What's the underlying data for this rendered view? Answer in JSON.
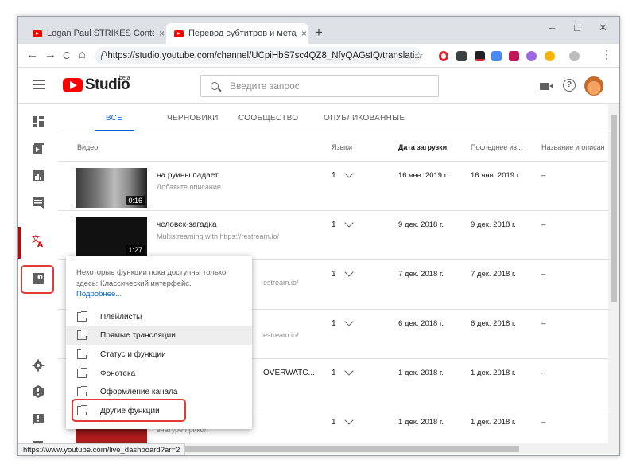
{
  "browser": {
    "tabs": [
      {
        "title": "Logan Paul STRIKES Content, Poi",
        "close": "×",
        "active": false
      },
      {
        "title": "Перевод субтитров и метаданн",
        "close": "×",
        "active": true
      }
    ],
    "new_tab": "+",
    "window_controls": [
      "–",
      "☐",
      "✕"
    ],
    "url": "https://studio.youtube.com/channel/UCpiHbS7sc4QZ8_NfyQAGsIQ/translati...",
    "nav": {
      "back": "←",
      "forward": "→",
      "reload": "C",
      "home": "⌂"
    },
    "star": "☆",
    "menu": "⋮",
    "status_url": "https://www.youtube.com/live_dashboard?ar=2"
  },
  "studio": {
    "logo_text": "Studio",
    "logo_badge": "beta",
    "search_placeholder": "Введите запрос",
    "help": "?"
  },
  "content_tabs": [
    "ВСЕ",
    "ЧЕРНОВИКИ",
    "СООБЩЕСТВО",
    "ОПУБЛИКОВАННЫЕ"
  ],
  "table": {
    "headers": {
      "video": "Видео",
      "languages": "Языки",
      "upload_date": "Дата загрузки",
      "last": "Последнее из...",
      "name_desc": "Название и описан"
    },
    "rows": [
      {
        "title": "на руины падает",
        "desc": "Добавьте описание",
        "duration": "0:16",
        "lang": "1",
        "date": "16 янв. 2019 г.",
        "last": "16 янв. 2019 г.",
        "name": "–"
      },
      {
        "title": "человек-загадка",
        "desc": "Multistreaming with https://restream.io/",
        "duration": "1:27",
        "lang": "1",
        "date": "9 дек. 2018 г.",
        "last": "9 дек. 2018 г.",
        "name": "–"
      },
      {
        "title": "",
        "desc": "estream.io/",
        "duration": "",
        "lang": "1",
        "date": "7 дек. 2018 г.",
        "last": "7 дек. 2018 г.",
        "name": "–"
      },
      {
        "title": "",
        "desc": "estream.io/",
        "duration": "",
        "lang": "1",
        "date": "6 дек. 2018 г.",
        "last": "6 дек. 2018 г.",
        "name": "–"
      },
      {
        "title": "OVERWATC...",
        "desc": "",
        "duration": "",
        "lang": "1",
        "date": "1 дек. 2018 г.",
        "last": "1 дек. 2018 г.",
        "name": "–"
      },
      {
        "title": "",
        "desc": "внатуре прикол",
        "duration": "",
        "lang": "1",
        "date": "1 дек. 2018 г.",
        "last": "1 дек. 2018 г.",
        "name": "–"
      }
    ]
  },
  "popup": {
    "note": "Некоторые функции пока доступны только здесь: Классический интерфейс.",
    "more": "Подробнее...",
    "items": [
      "Плейлисты",
      "Прямые трансляции",
      "Статус и функции",
      "Фонотека",
      "Оформление канала",
      "Другие функции"
    ]
  },
  "colors": {
    "accent": "#065fd4",
    "brand": "#ff0000",
    "highlight": "#e53935"
  }
}
